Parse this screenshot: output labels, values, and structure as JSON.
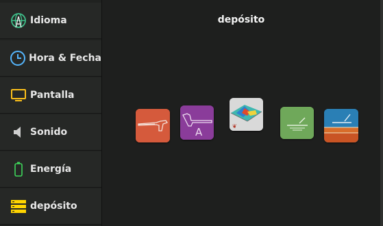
{
  "sidebar": {
    "items": [
      {
        "label": "Idioma",
        "icon": "globe-antenna-icon"
      },
      {
        "label": "Hora & Fecha",
        "icon": "clock-icon"
      },
      {
        "label": "Pantalla",
        "icon": "monitor-icon"
      },
      {
        "label": "Sonido",
        "icon": "speaker-icon"
      },
      {
        "label": "Energía",
        "icon": "battery-icon"
      },
      {
        "label": "depósito",
        "icon": "storage-icon"
      }
    ],
    "active_index": 5
  },
  "main": {
    "title": "depósito",
    "apps": [
      {
        "icon": "detector-orange-icon",
        "color": "#d55a3c"
      },
      {
        "icon": "detector-a-purple-icon",
        "color": "#8a3c9a",
        "text": "A"
      },
      {
        "icon": "3d-terrain-icon",
        "color": "#d9d9d9"
      },
      {
        "icon": "detector-green-icon",
        "color": "#6fa85a"
      },
      {
        "icon": "detector-ground-icon",
        "color": "#2a7fb5"
      }
    ]
  },
  "colors": {
    "background": "#1e1f1e",
    "sidebar": "#262826",
    "accent": "#ffd400"
  }
}
